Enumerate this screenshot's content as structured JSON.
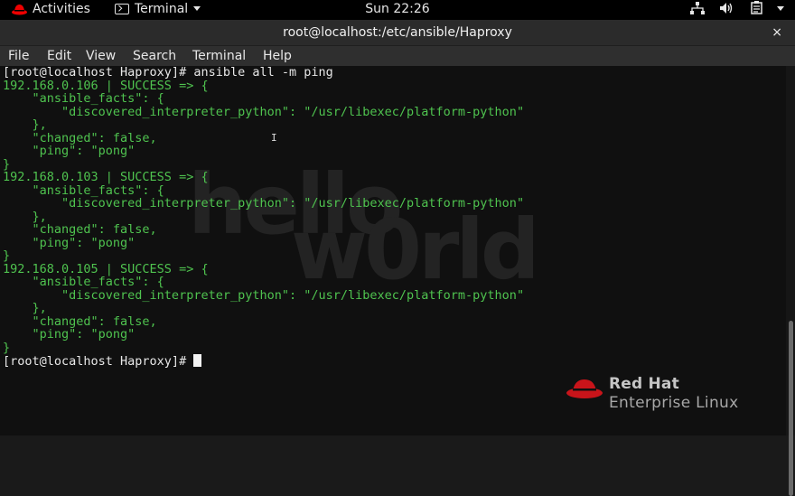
{
  "topbar": {
    "activities": "Activities",
    "app_menu": "Terminal",
    "clock": "Sun 22:26",
    "icons": [
      "network-icon",
      "volume-icon",
      "clipboard-icon",
      "system-menu-chevron-icon"
    ]
  },
  "window": {
    "title": "root@localhost:/etc/ansible/Haproxy",
    "close_glyph": "×"
  },
  "menu": {
    "file": "File",
    "edit": "Edit",
    "view": "View",
    "search": "Search",
    "terminal": "Terminal",
    "help": "Help"
  },
  "wallpaper": {
    "hello": "hello",
    "world": "w0rld",
    "brand_line1": "Red Hat",
    "brand_line2": "Enterprise Linux"
  },
  "terminal": {
    "prompt": "[root@localhost Haproxy]# ",
    "command": "ansible all -m ping",
    "lines": [
      "192.168.0.106 | SUCCESS => {",
      "    \"ansible_facts\": {",
      "        \"discovered_interpreter_python\": \"/usr/libexec/platform-python\"",
      "    },",
      "    \"changed\": false,",
      "    \"ping\": \"pong\"",
      "}",
      "192.168.0.103 | SUCCESS => {",
      "    \"ansible_facts\": {",
      "        \"discovered_interpreter_python\": \"/usr/libexec/platform-python\"",
      "    },",
      "    \"changed\": false,",
      "    \"ping\": \"pong\"",
      "}",
      "192.168.0.105 | SUCCESS => {",
      "    \"ansible_facts\": {",
      "        \"discovered_interpreter_python\": \"/usr/libexec/platform-python\"",
      "    },",
      "    \"changed\": false,",
      "    \"ping\": \"pong\"",
      "}"
    ],
    "final_prompt": "[root@localhost Haproxy]# "
  },
  "colors": {
    "output_green": "#4fc34f",
    "prompt_white": "#e8e8e8",
    "background": "#101010"
  }
}
